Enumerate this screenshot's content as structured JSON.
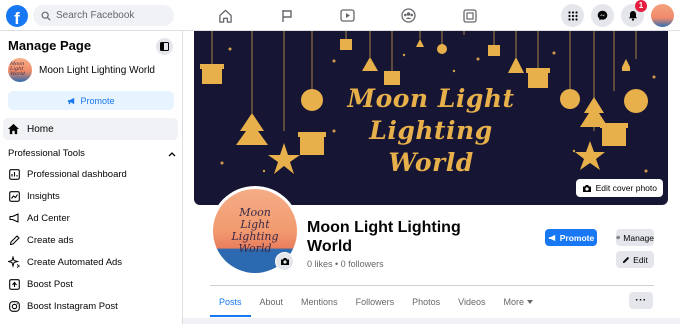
{
  "topbar": {
    "logo_letter": "f",
    "search_placeholder": "Search Facebook",
    "nav_icons": [
      "home-icon",
      "flag-icon",
      "video-icon",
      "groups-icon",
      "gaming-icon"
    ],
    "right_icons": [
      "menu-grid-icon",
      "messenger-icon",
      "notifications-icon"
    ],
    "notification_count": "1"
  },
  "sidebar": {
    "title": "Manage Page",
    "page_name": "Moon Light Lighting World",
    "promote_label": "Promote",
    "home_label": "Home",
    "section_label": "Professional Tools",
    "items": [
      {
        "label": "Professional dashboard",
        "icon": "dashboard-icon"
      },
      {
        "label": "Insights",
        "icon": "insights-icon"
      },
      {
        "label": "Ad Center",
        "icon": "megaphone-icon"
      },
      {
        "label": "Create ads",
        "icon": "pencil-icon"
      },
      {
        "label": "Create Automated Ads",
        "icon": "sparkle-icon"
      },
      {
        "label": "Boost Post",
        "icon": "boost-icon"
      },
      {
        "label": "Boost Instagram Post",
        "icon": "instagram-icon"
      }
    ]
  },
  "cover": {
    "title_line1": "Moon Light",
    "title_line2": "Lighting",
    "title_line3": "World",
    "edit_cover_label": "Edit cover photo"
  },
  "profile": {
    "logo_line1": "Moon",
    "logo_line2": "Light",
    "logo_line3": "Lighting",
    "logo_line4": "World",
    "name": "Moon Light Lighting World",
    "stats": "0 likes • 0 followers"
  },
  "actions": {
    "promote": "Promote",
    "manage": "Manage",
    "edit": "Edit",
    "more": "···"
  },
  "tabs": [
    "Posts",
    "About",
    "Mentions",
    "Followers",
    "Photos",
    "Videos",
    "More"
  ],
  "colors": {
    "brand_blue": "#1877f2",
    "cover_bg": "#161634",
    "gold": "#e8b04a"
  }
}
